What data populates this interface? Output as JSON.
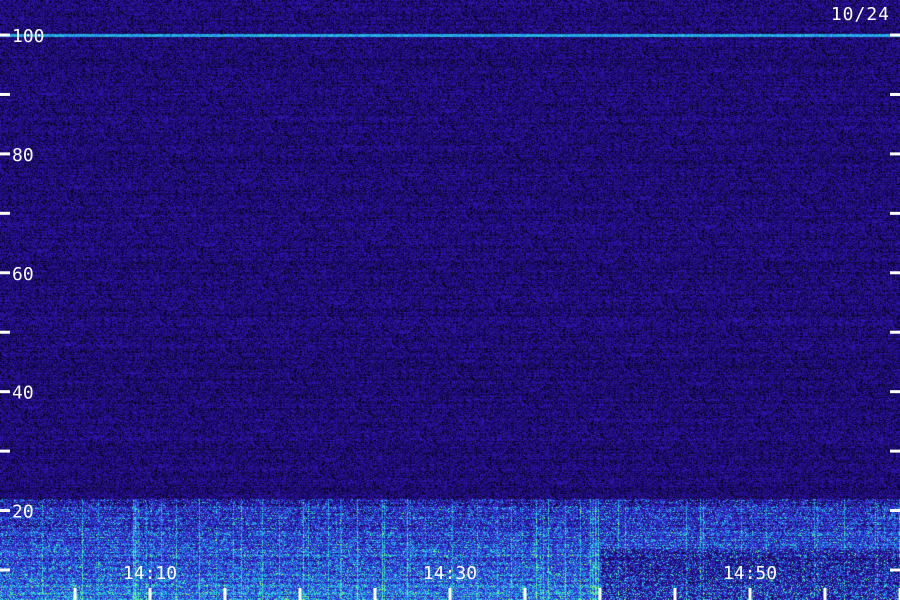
{
  "date_label": "10/24",
  "chart_data": {
    "type": "heatmap",
    "title": "",
    "xlabel": "",
    "ylabel": "",
    "y_range": [
      10,
      100
    ],
    "y_labeled_ticks": [
      100,
      80,
      60,
      40,
      20
    ],
    "y_all_ticks": [
      100,
      90,
      80,
      70,
      60,
      50,
      40,
      30,
      20,
      10
    ],
    "x_range": [
      "14:05",
      "15:05"
    ],
    "x_labeled_ticks": [
      "14:10",
      "14:30",
      "14:50"
    ],
    "x_minor_tick_interval_minutes": 5,
    "colormap": [
      "#000000",
      "#1a0b6b",
      "#3a18c9",
      "#2f5ae6",
      "#1fb3e8",
      "#3ef0c8",
      "#9cff5a"
    ],
    "features": [
      {
        "kind": "narrowband-line",
        "y": 100,
        "intensity": "medium"
      },
      {
        "kind": "broadband-emission",
        "y_range": [
          10,
          22
        ],
        "intensity": "high"
      },
      {
        "kind": "background-noise",
        "y_range": [
          22,
          100
        ],
        "intensity": "low"
      }
    ]
  }
}
